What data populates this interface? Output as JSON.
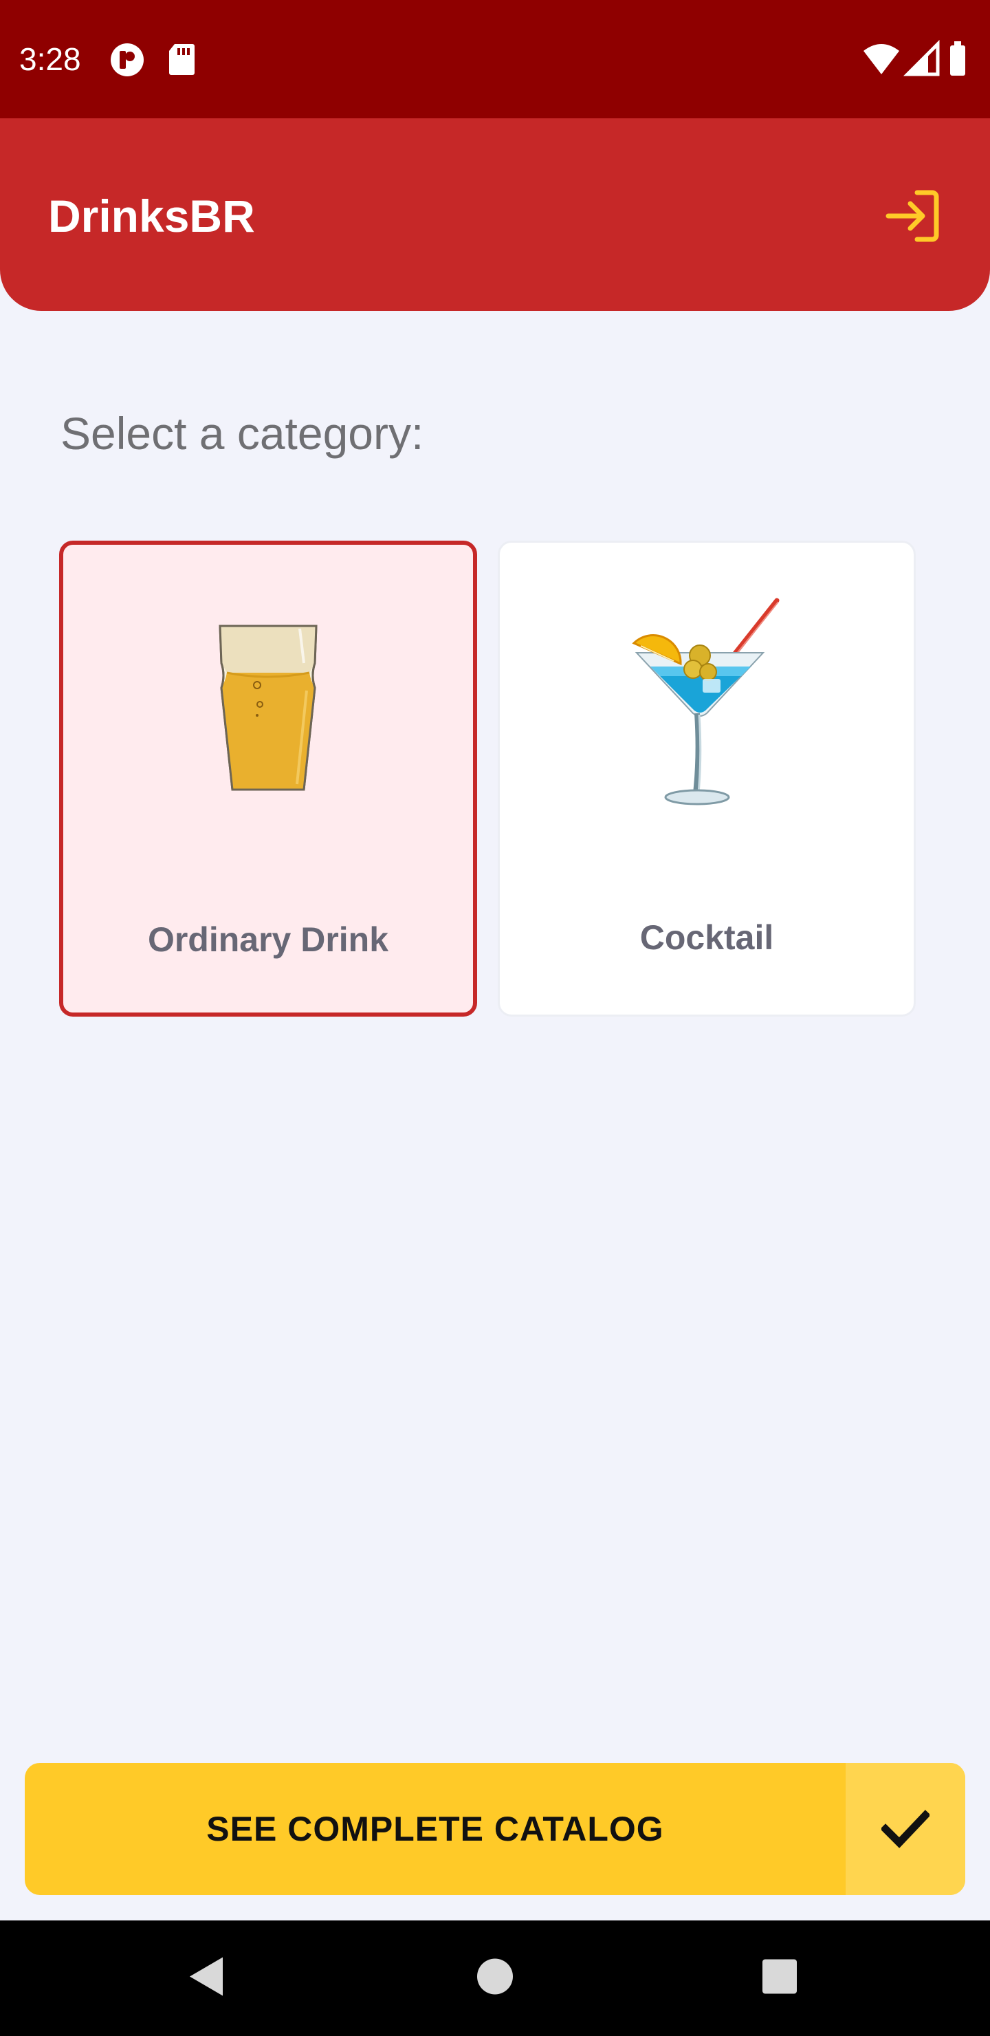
{
  "status_bar": {
    "time": "3:28",
    "icons_left": [
      "notification-p-icon",
      "sd-card-icon"
    ],
    "icons_right": [
      "wifi-icon",
      "cell-signal-icon",
      "battery-icon"
    ]
  },
  "app_bar": {
    "title": "DrinksBR",
    "action_icon": "login-icon"
  },
  "main": {
    "prompt": "Select a category:",
    "categories": [
      {
        "label": "Ordinary Drink",
        "icon": "beer-glass-icon",
        "selected": true
      },
      {
        "label": "Cocktail",
        "icon": "cocktail-glass-icon",
        "selected": false
      }
    ]
  },
  "catalog_button": {
    "label": "SEE COMPLETE CATALOG",
    "icon": "check-icon"
  },
  "navigation": {
    "buttons": [
      "back-icon",
      "home-icon",
      "recents-icon"
    ]
  },
  "colors": {
    "status_bar": "#8f0000",
    "app_bar": "#c62828",
    "accent_yellow": "#ffca28",
    "background": "#f2f3fb",
    "selected_card_bg": "#ffebee"
  }
}
